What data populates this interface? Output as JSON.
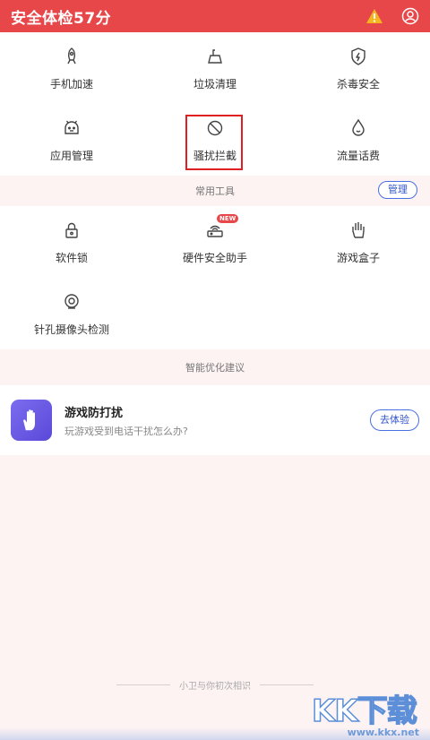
{
  "header": {
    "title": "安全体检57分",
    "warning_icon": "warning-triangle-icon",
    "user_icon": "user-circle-icon",
    "accent": "#e8474a"
  },
  "main_grid": [
    {
      "label": "手机加速",
      "icon": "rocket-icon"
    },
    {
      "label": "垃圾清理",
      "icon": "trash-icon"
    },
    {
      "label": "杀毒安全",
      "icon": "shield-lightning-icon"
    },
    {
      "label": "应用管理",
      "icon": "android-icon"
    },
    {
      "label": "骚扰拦截",
      "icon": "block-icon"
    },
    {
      "label": "流量话费",
      "icon": "water-drop-icon"
    }
  ],
  "tools_section": {
    "title": "常用工具",
    "manage_label": "管理"
  },
  "tools_grid": [
    {
      "label": "软件锁",
      "icon": "lock-icon"
    },
    {
      "label": "硬件安全助手",
      "icon": "router-icon",
      "badge": "NEW"
    },
    {
      "label": "游戏盒子",
      "icon": "hand-icon"
    },
    {
      "label": "针孔摄像头检测",
      "icon": "camera-icon"
    }
  ],
  "suggest_section": {
    "title": "智能优化建议"
  },
  "card": {
    "title": "游戏防打扰",
    "subtitle": "玩游戏受到电话干扰怎么办?",
    "button": "去体验"
  },
  "footer": {
    "text": "小卫与你初次相识"
  },
  "watermark": {
    "main": "KK下载",
    "url": "www.kkx.net"
  }
}
